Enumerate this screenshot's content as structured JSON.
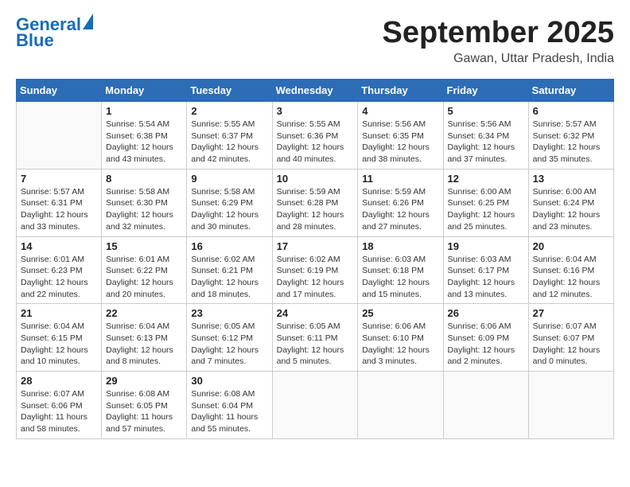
{
  "logo": {
    "line1": "General",
    "line2": "Blue"
  },
  "title": "September 2025",
  "subtitle": "Gawan, Uttar Pradesh, India",
  "days_of_week": [
    "Sunday",
    "Monday",
    "Tuesday",
    "Wednesday",
    "Thursday",
    "Friday",
    "Saturday"
  ],
  "weeks": [
    [
      {
        "day": "",
        "info": ""
      },
      {
        "day": "1",
        "info": "Sunrise: 5:54 AM\nSunset: 6:38 PM\nDaylight: 12 hours\nand 43 minutes."
      },
      {
        "day": "2",
        "info": "Sunrise: 5:55 AM\nSunset: 6:37 PM\nDaylight: 12 hours\nand 42 minutes."
      },
      {
        "day": "3",
        "info": "Sunrise: 5:55 AM\nSunset: 6:36 PM\nDaylight: 12 hours\nand 40 minutes."
      },
      {
        "day": "4",
        "info": "Sunrise: 5:56 AM\nSunset: 6:35 PM\nDaylight: 12 hours\nand 38 minutes."
      },
      {
        "day": "5",
        "info": "Sunrise: 5:56 AM\nSunset: 6:34 PM\nDaylight: 12 hours\nand 37 minutes."
      },
      {
        "day": "6",
        "info": "Sunrise: 5:57 AM\nSunset: 6:32 PM\nDaylight: 12 hours\nand 35 minutes."
      }
    ],
    [
      {
        "day": "7",
        "info": "Sunrise: 5:57 AM\nSunset: 6:31 PM\nDaylight: 12 hours\nand 33 minutes."
      },
      {
        "day": "8",
        "info": "Sunrise: 5:58 AM\nSunset: 6:30 PM\nDaylight: 12 hours\nand 32 minutes."
      },
      {
        "day": "9",
        "info": "Sunrise: 5:58 AM\nSunset: 6:29 PM\nDaylight: 12 hours\nand 30 minutes."
      },
      {
        "day": "10",
        "info": "Sunrise: 5:59 AM\nSunset: 6:28 PM\nDaylight: 12 hours\nand 28 minutes."
      },
      {
        "day": "11",
        "info": "Sunrise: 5:59 AM\nSunset: 6:26 PM\nDaylight: 12 hours\nand 27 minutes."
      },
      {
        "day": "12",
        "info": "Sunrise: 6:00 AM\nSunset: 6:25 PM\nDaylight: 12 hours\nand 25 minutes."
      },
      {
        "day": "13",
        "info": "Sunrise: 6:00 AM\nSunset: 6:24 PM\nDaylight: 12 hours\nand 23 minutes."
      }
    ],
    [
      {
        "day": "14",
        "info": "Sunrise: 6:01 AM\nSunset: 6:23 PM\nDaylight: 12 hours\nand 22 minutes."
      },
      {
        "day": "15",
        "info": "Sunrise: 6:01 AM\nSunset: 6:22 PM\nDaylight: 12 hours\nand 20 minutes."
      },
      {
        "day": "16",
        "info": "Sunrise: 6:02 AM\nSunset: 6:21 PM\nDaylight: 12 hours\nand 18 minutes."
      },
      {
        "day": "17",
        "info": "Sunrise: 6:02 AM\nSunset: 6:19 PM\nDaylight: 12 hours\nand 17 minutes."
      },
      {
        "day": "18",
        "info": "Sunrise: 6:03 AM\nSunset: 6:18 PM\nDaylight: 12 hours\nand 15 minutes."
      },
      {
        "day": "19",
        "info": "Sunrise: 6:03 AM\nSunset: 6:17 PM\nDaylight: 12 hours\nand 13 minutes."
      },
      {
        "day": "20",
        "info": "Sunrise: 6:04 AM\nSunset: 6:16 PM\nDaylight: 12 hours\nand 12 minutes."
      }
    ],
    [
      {
        "day": "21",
        "info": "Sunrise: 6:04 AM\nSunset: 6:15 PM\nDaylight: 12 hours\nand 10 minutes."
      },
      {
        "day": "22",
        "info": "Sunrise: 6:04 AM\nSunset: 6:13 PM\nDaylight: 12 hours\nand 8 minutes."
      },
      {
        "day": "23",
        "info": "Sunrise: 6:05 AM\nSunset: 6:12 PM\nDaylight: 12 hours\nand 7 minutes."
      },
      {
        "day": "24",
        "info": "Sunrise: 6:05 AM\nSunset: 6:11 PM\nDaylight: 12 hours\nand 5 minutes."
      },
      {
        "day": "25",
        "info": "Sunrise: 6:06 AM\nSunset: 6:10 PM\nDaylight: 12 hours\nand 3 minutes."
      },
      {
        "day": "26",
        "info": "Sunrise: 6:06 AM\nSunset: 6:09 PM\nDaylight: 12 hours\nand 2 minutes."
      },
      {
        "day": "27",
        "info": "Sunrise: 6:07 AM\nSunset: 6:07 PM\nDaylight: 12 hours\nand 0 minutes."
      }
    ],
    [
      {
        "day": "28",
        "info": "Sunrise: 6:07 AM\nSunset: 6:06 PM\nDaylight: 11 hours\nand 58 minutes."
      },
      {
        "day": "29",
        "info": "Sunrise: 6:08 AM\nSunset: 6:05 PM\nDaylight: 11 hours\nand 57 minutes."
      },
      {
        "day": "30",
        "info": "Sunrise: 6:08 AM\nSunset: 6:04 PM\nDaylight: 11 hours\nand 55 minutes."
      },
      {
        "day": "",
        "info": ""
      },
      {
        "day": "",
        "info": ""
      },
      {
        "day": "",
        "info": ""
      },
      {
        "day": "",
        "info": ""
      }
    ]
  ]
}
